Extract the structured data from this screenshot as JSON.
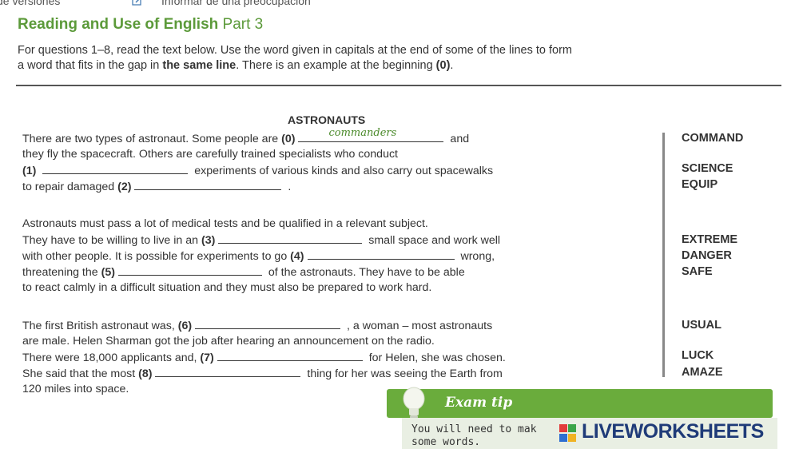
{
  "topbar": {
    "left_text": "de versiones",
    "report_text": "Informar de una preocupación"
  },
  "title": {
    "main": "Reading and Use of English",
    "part": "Part 3"
  },
  "instructions": {
    "line1": "For questions 1–8, read the text below. Use the word given in capitals at the end of some of the lines to form",
    "line2a": "a word that fits in the gap in ",
    "line2b": "the same line",
    "line2c": ". There is an example at the beginning ",
    "line2d": "(0)",
    "line2e": "."
  },
  "text_heading": "ASTRONAUTS",
  "example_answer": "commanders",
  "lines": {
    "l1a": "There are two types of astronaut. Some people are ",
    "l1n": "(0)",
    "l1b": " and",
    "l2": "they fly the spacecraft. Others are carefully trained specialists who conduct",
    "l3n": "(1)",
    "l3b": " experiments of various kinds and also carry out spacewalks",
    "l4a": "to repair damaged ",
    "l4n": "(2)",
    "l4b": " .",
    "l5": "Astronauts must pass a lot of medical tests and be qualified in a relevant subject.",
    "l6a": "They have to be willing to live in an ",
    "l6n": "(3)",
    "l6b": " small space and work well",
    "l7a": "with other people. It is possible for experiments to go ",
    "l7n": "(4)",
    "l7b": " wrong,",
    "l8a": "threatening the ",
    "l8n": "(5)",
    "l8b": " of the astronauts. They have to be able",
    "l9": "to react calmly in a difficult situation and they must also be prepared to work hard.",
    "l10a": "The first British astronaut was, ",
    "l10n": "(6)",
    "l10b": " , a woman – most astronauts",
    "l11": "are male. Helen Sharman got the job after hearing an announcement on the radio.",
    "l12a": "There were 18,000 applicants and, ",
    "l12n": "(7)",
    "l12b": " for Helen, she was chosen.",
    "l13a": "She said that the most ",
    "l13n": "(8)",
    "l13b": " thing for her was seeing the Earth from",
    "l14": "120 miles into space."
  },
  "keywords": [
    "COMMAND",
    "SCIENCE",
    "EQUIP",
    "EXTREME",
    "DANGER",
    "SAFE",
    "USUAL",
    "LUCK",
    "AMAZE"
  ],
  "exam_tip": {
    "title": "Exam tip",
    "line1": "You will need to mak",
    "line2": "some words."
  },
  "watermark": {
    "text": "LIVEWORKSHEETS"
  },
  "colors": {
    "accent_green": "#5c9a3a",
    "tip_green": "#6aac3c",
    "watermark_blue": "#1f3b78"
  }
}
